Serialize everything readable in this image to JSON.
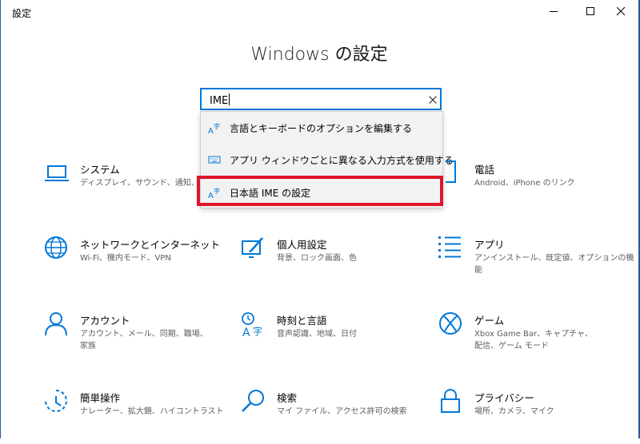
{
  "window": {
    "title": "設定"
  },
  "page": {
    "title": "Windows の設定"
  },
  "search": {
    "value": "IME"
  },
  "suggestions": [
    {
      "label": "言語とキーボードのオプションを編集する",
      "icon": "language-a-icon"
    },
    {
      "label": "アプリ ウィンドウごとに異なる入力方式を使用する",
      "icon": "keyboard-icon"
    },
    {
      "label": "日本語 IME の設定",
      "icon": "language-a-icon"
    }
  ],
  "tiles": [
    {
      "title": "システム",
      "desc": "ディスプレイ、サウンド、通知、電源",
      "icon": "laptop-icon"
    },
    {
      "title": "電話",
      "desc": "Android、iPhone のリンク",
      "icon": "phone-icon"
    },
    {
      "title": "ネットワークとインターネット",
      "desc": "Wi-Fi、機内モード、VPN",
      "icon": "globe-icon"
    },
    {
      "title": "個人用設定",
      "desc": "背景、ロック画面、色",
      "icon": "paintbrush-icon"
    },
    {
      "title": "アプリ",
      "desc": "アンインストール、既定値、オプションの機能",
      "icon": "apps-list-icon"
    },
    {
      "title": "アカウント",
      "desc": "アカウント、メール、同期、職場、家族",
      "icon": "person-icon"
    },
    {
      "title": "時刻と言語",
      "desc": "音声認識、地域、日付",
      "icon": "time-language-icon"
    },
    {
      "title": "ゲーム",
      "desc": "Xbox Game Bar、キャプチャ、配信、ゲーム モード",
      "icon": "xbox-icon"
    },
    {
      "title": "簡単操作",
      "desc": "ナレーター、拡大鏡、ハイコントラスト",
      "icon": "ease-of-access-icon"
    },
    {
      "title": "検索",
      "desc": "マイ ファイル、アクセス許可の検索",
      "icon": "search-icon"
    },
    {
      "title": "プライバシー",
      "desc": "場所、カメラ、マイク",
      "icon": "lock-icon"
    }
  ],
  "colors": {
    "accent": "#0078d7",
    "highlight": "#e0142a"
  }
}
